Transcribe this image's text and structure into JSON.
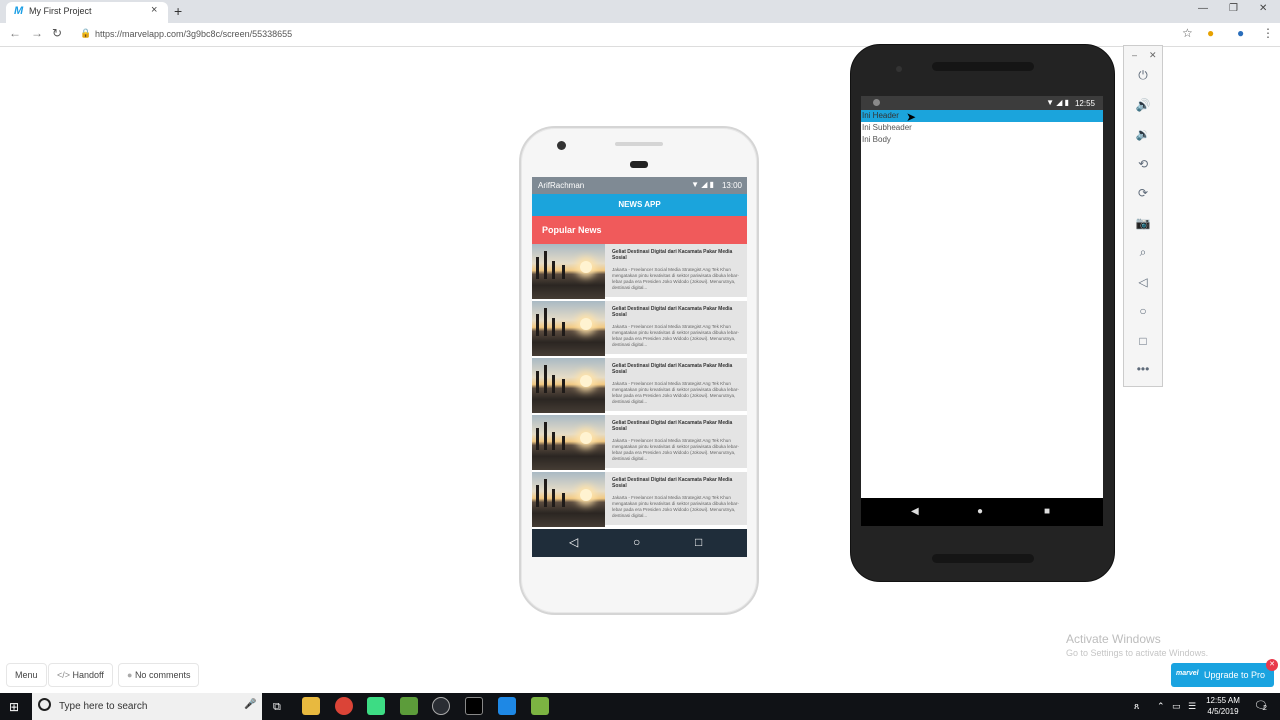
{
  "browser": {
    "tab_title": "My First Project",
    "tab_close": "×",
    "new_tab": "+",
    "url": "https://marvelapp.com/3g9bc8c/screen/55338655",
    "window_controls": [
      "—",
      "❐",
      "✕"
    ]
  },
  "marvel_phone": {
    "status_name": "ArifRachman",
    "status_time": "13:00",
    "app_title": "NEWS APP",
    "section_title": "Popular News",
    "news_items": [
      {
        "title": "Geliat Destinasi Digital dari Kacamata Pakar Media Sosial",
        "body": "Jakarta - Freelancer Social Media Strategist Ang Tek Khun mengatakan pintu kreativitas di sektor pariwisata dibuka lebar-lebar pada era Presiden Joko Widodo (Jokowi). Menurutnya, destinasi digital..."
      },
      {
        "title": "Geliat Destinasi Digital dari Kacamata Pakar Media Sosial",
        "body": "Jakarta - Freelancer Social Media Strategist Ang Tek Khun mengatakan pintu kreativitas di sektor pariwisata dibuka lebar-lebar pada era Presiden Joko Widodo (Jokowi). Menurutnya, destinasi digital..."
      },
      {
        "title": "Geliat Destinasi Digital dari Kacamata Pakar Media Sosial",
        "body": "Jakarta - Freelancer Social Media Strategist Ang Tek Khun mengatakan pintu kreativitas di sektor pariwisata dibuka lebar-lebar pada era Presiden Joko Widodo (Jokowi). Menurutnya, destinasi digital..."
      },
      {
        "title": "Geliat Destinasi Digital dari Kacamata Pakar Media Sosial",
        "body": "Jakarta - Freelancer Social Media Strategist Ang Tek Khun mengatakan pintu kreativitas di sektor pariwisata dibuka lebar-lebar pada era Presiden Joko Widodo (Jokowi). Menurutnya, destinasi digital..."
      },
      {
        "title": "Geliat Destinasi Digital dari Kacamata Pakar Media Sosial",
        "body": "Jakarta - Freelancer Social Media Strategist Ang Tek Khun mengatakan pintu kreativitas di sektor pariwisata dibuka lebar-lebar pada era Presiden Joko Widodo (Jokowi). Menurutnya, destinasi digital..."
      }
    ]
  },
  "emulator": {
    "status_time": "12:55",
    "header_text": "Ini Header",
    "subheader_text": "Ini Subheader",
    "body_text": "Ini Body",
    "toolbar_icons": [
      "power-icon",
      "volume-up-icon",
      "volume-down-icon",
      "rotate-left-icon",
      "rotate-right-icon",
      "camera-icon",
      "zoom-icon",
      "back-icon",
      "home-icon",
      "overview-icon",
      "more-icon"
    ]
  },
  "marvel_bottom": {
    "menu_label": "Menu",
    "handoff_label": "Handoff",
    "comments_label": "No comments",
    "upgrade_label": "Upgrade to Pro",
    "upgrade_logo": "marvel"
  },
  "windows": {
    "activate_title": "Activate Windows",
    "activate_sub": "Go to Settings to activate Windows.",
    "search_placeholder": "Type here to search",
    "clock_time": "12:55 AM",
    "clock_date": "4/5/2019",
    "notification_count": "2"
  },
  "colors": {
    "accent_blue": "#1ba4dc",
    "popular_red": "#f05a5b",
    "nav_dark": "#1f2d3a"
  }
}
